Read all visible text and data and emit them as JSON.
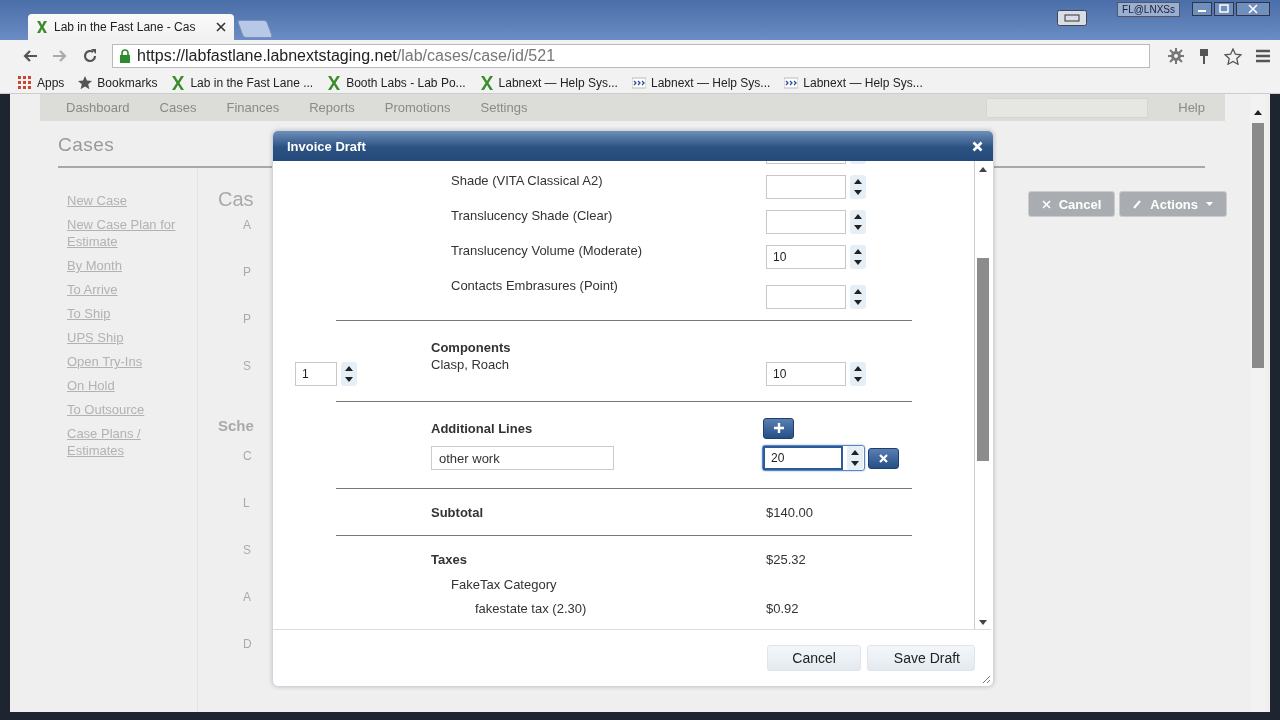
{
  "browser": {
    "tab_title": "Lab in the Fast Lane - Cas",
    "user_badge": "FL@LNXSs",
    "url_host": "https://labfastlane.labnextstaging.net",
    "url_path": "/lab/cases/case/id/521",
    "bookmarks": [
      {
        "label": "Apps",
        "kind": "apps"
      },
      {
        "label": "Bookmarks",
        "kind": "star"
      },
      {
        "label": "Lab in the Fast Lane ...",
        "kind": "x"
      },
      {
        "label": "Booth Labs - Lab Po...",
        "kind": "x"
      },
      {
        "label": "Labnext — Help Sys...",
        "kind": "x"
      },
      {
        "label": "Labnext — Help Sys...",
        "kind": "chevrons"
      },
      {
        "label": "Labnext — Help Sys...",
        "kind": "chevrons"
      }
    ]
  },
  "app": {
    "nav": [
      "Dashboard",
      "Cases",
      "Finances",
      "Reports",
      "Promotions",
      "Settings"
    ],
    "help": "Help",
    "page_title": "Cases",
    "sidebar_links": [
      "New Case",
      "New Case Plan for Estimate",
      "By Month",
      "To Arrive",
      "To Ship",
      "UPS Ship",
      "Open Try-Ins",
      "On Hold",
      "To Outsource",
      "Case Plans / Estimates"
    ],
    "main_title": "Cas",
    "field_labels": [
      "A",
      "P",
      "P",
      "S"
    ],
    "section_title": "Sche",
    "section_labels": [
      "C",
      "L",
      "S",
      "A",
      "D"
    ],
    "buttons": [
      {
        "label": "Cancel",
        "kind": "cancel"
      },
      {
        "label": "Actions",
        "kind": "actions"
      }
    ]
  },
  "dialog": {
    "title": "Invoice Draft",
    "attributes": [
      {
        "label": "Shade (VITA Classical A2)"
      },
      {
        "label": "Translucency Shade (Clear)"
      },
      {
        "label": "Translucency Volume (Moderate)",
        "value": "10"
      },
      {
        "label": "Contacts Embrasures (Point)"
      }
    ],
    "components": {
      "title": "Components",
      "items": [
        {
          "quantity": "1",
          "name": "Clasp, Roach",
          "price": "10"
        }
      ]
    },
    "additional_lines": {
      "title": "Additional Lines",
      "items": [
        {
          "description": "other work",
          "amount": "20",
          "focused": true
        }
      ]
    },
    "subtotal": {
      "label": "Subtotal",
      "value": "$140.00"
    },
    "taxes": {
      "label": "Taxes",
      "value": "$25.32",
      "categories": [
        {
          "name": "FakeTax Category",
          "children": [
            {
              "name": "fakestate tax (2.30)",
              "value": "$0.92"
            }
          ]
        }
      ]
    },
    "buttons": [
      {
        "label": "Cancel",
        "kind": "secondary"
      },
      {
        "label": "Save Draft",
        "kind": "primary"
      }
    ]
  }
}
